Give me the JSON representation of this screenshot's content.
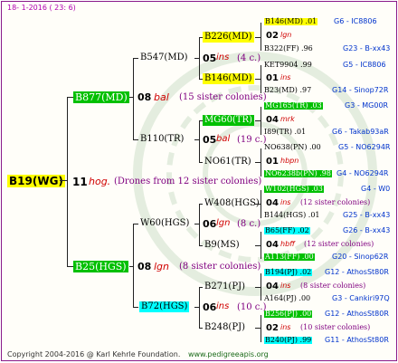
{
  "header": "18-  1-2016 ( 23:  6)",
  "footer": {
    "left": "Copyright 2004-2016 @ Karl Kehrle Foundation.",
    "right": "www.pedigreeapis.org"
  },
  "root": {
    "id": "B19(WG)",
    "gen": "11",
    "tag": "hog.",
    "note": "(Drones from 12 sister colonies)"
  },
  "l1": [
    {
      "id": "B877(MD)",
      "gen": "08",
      "tag": "bal",
      "note": "(15 sister colonies)"
    },
    {
      "id": "B25(HGS)",
      "gen": "08",
      "tag": "lgn",
      "note": "(8 sister colonies)"
    }
  ],
  "l2": [
    {
      "id": "B547(MD)",
      "gen": "05",
      "tag": "ins",
      "note": "(4 c.)"
    },
    {
      "id": "B110(TR)",
      "gen": "05",
      "tag": "bal",
      "note": "(19 c.)"
    },
    {
      "id": "W60(HGS)",
      "gen": "06",
      "tag": "lgn",
      "note": "(8 c.)"
    },
    {
      "id": "B72(HGS)",
      "gen": "06",
      "tag": "ins",
      "note": "(10 c.)"
    }
  ],
  "l3": [
    {
      "id": "B226(MD)"
    },
    {
      "id": "B146(MD)"
    },
    {
      "id": "MG60(TR)"
    },
    {
      "id": "NO61(TR)"
    },
    {
      "id": "W408(HGS)"
    },
    {
      "id": "B9(MS)"
    },
    {
      "id": "B271(PJ)"
    },
    {
      "id": "B248(PJ)"
    }
  ],
  "l4": [
    {
      "a": "B146(MD) .01",
      "b": "G6 - IC8806"
    },
    {
      "a": "02",
      "t": "lgn"
    },
    {
      "a": "B322(FF) .96",
      "b": "G23 - B-xx43"
    },
    {
      "a": "KET9904 .99",
      "b": "G5 - IC8806"
    },
    {
      "a": "01",
      "t": "ins"
    },
    {
      "a": "B23(MD) .97",
      "b": "G14 - Sinop72R"
    },
    {
      "a": "MG165(TR) .03",
      "b": "G3 - MG00R"
    },
    {
      "a": "04",
      "t": "mrk"
    },
    {
      "a": "I89(TR) .01",
      "b": "G6 - Takab93aR"
    },
    {
      "a": "NO638(PN) .00",
      "b": "G5 - NO6294R"
    },
    {
      "a": "01",
      "t": "hbpn"
    },
    {
      "a": "NO6238b(PN) .98",
      "b": "G4 - NO6294R"
    },
    {
      "a": "W102(HGS) .03",
      "b": "G4 - W0"
    },
    {
      "a": "04",
      "t": "ins",
      "n": "(12 sister colonies)"
    },
    {
      "a": "B144(HGS) .01",
      "b": "G25 - B-xx43"
    },
    {
      "a": "B65(FF) .02",
      "b": "G26 - B-xx43"
    },
    {
      "a": "04",
      "t": "hbff",
      "n": "(12 sister colonies)"
    },
    {
      "a": "A113(FF) .00",
      "b": "G20 - Sinop62R"
    },
    {
      "a": "B194(PJ) .02",
      "b": "G12 - AthosSt80R"
    },
    {
      "a": "04",
      "t": "ins",
      "n": "(8 sister colonies)"
    },
    {
      "a": "A164(PJ) .00",
      "b": "G3 - Cankiri97Q"
    },
    {
      "a": "B256(PJ) .00",
      "b": "G12 - AthosSt80R"
    },
    {
      "a": "02",
      "t": "ins",
      "n": "(10 sister colonies)"
    },
    {
      "a": "B240(PJ) .99",
      "b": "G11 - AthosSt80R"
    }
  ]
}
